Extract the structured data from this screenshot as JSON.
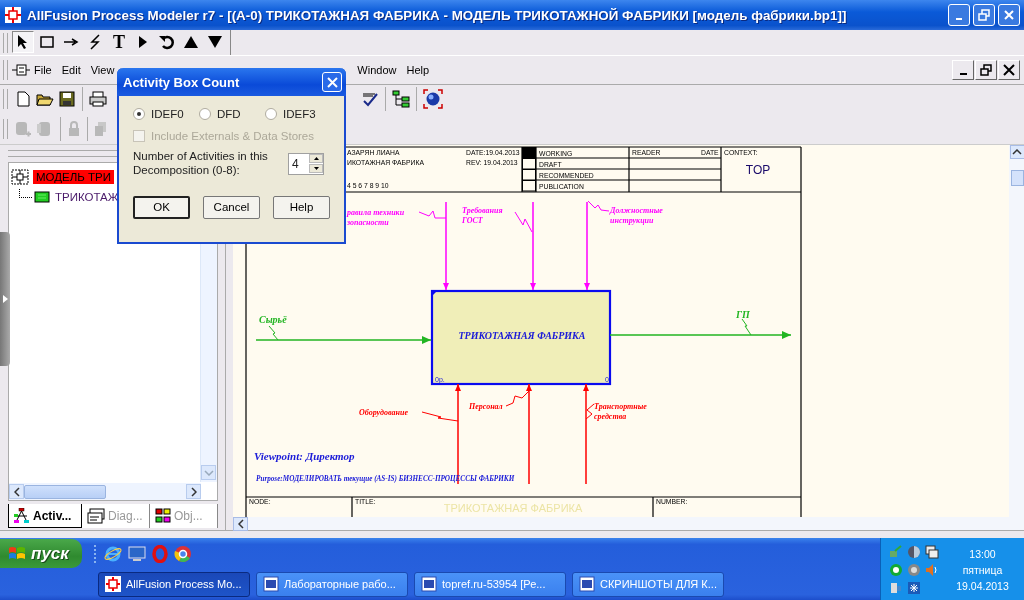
{
  "window": {
    "title": "AllFusion Process Modeler r7 - [(A-0) ТРИКОТАЖНАЯ ФАБРИКА - МОДЕЛЬ ТРИКОТАЖНОЙ ФАБРИКИ  [модель фабрики.bp1]]"
  },
  "drawing_toolbar": [
    {
      "kind": "pointer",
      "selected": true
    },
    {
      "kind": "box",
      "selected": false
    },
    {
      "kind": "arrow",
      "selected": false
    },
    {
      "kind": "squiggle",
      "selected": false
    },
    {
      "kind": "text",
      "glyph": "T",
      "selected": false
    },
    {
      "kind": "play",
      "selected": false
    },
    {
      "kind": "rotate",
      "selected": false
    },
    {
      "kind": "up",
      "selected": false
    },
    {
      "kind": "down",
      "selected": false
    }
  ],
  "menu": [
    "File",
    "Edit",
    "View",
    "Window",
    "Help"
  ],
  "standard_toolbar": [
    {
      "kind": "new"
    },
    {
      "kind": "open"
    },
    {
      "kind": "save"
    },
    {
      "kind": "print"
    },
    {
      "kind": "spellcheck"
    },
    {
      "kind": "tree"
    },
    {
      "kind": "globe"
    }
  ],
  "model_toolbar": [
    {
      "kind": "box-add"
    },
    {
      "kind": "box-remove"
    },
    {
      "kind": "lock"
    },
    {
      "kind": "copy"
    }
  ],
  "tree": [
    {
      "label": "МОДЕЛЬ ТРИ",
      "selected": true,
      "children": [
        {
          "label": "ТРИКОТАЖ",
          "selected": false
        }
      ]
    }
  ],
  "panel_tabs": [
    {
      "label": "Activ...",
      "kind": "activity",
      "selected": true
    },
    {
      "label": "Diag...",
      "kind": "diagram",
      "selected": false
    },
    {
      "label": "Obj...",
      "kind": "objects",
      "selected": false
    }
  ],
  "diagram": {
    "header": {
      "author": "АЗАРЯН ЛИАНА",
      "project": "ИКОТАЖНАЯ ФАБРИКА",
      "notes": "4  5  6  7  8  9  10",
      "date": "DATE:19.04.2013",
      "rev": "REV:   19.04.2013",
      "statuses": [
        {
          "label": "WORKING",
          "selected": true
        },
        {
          "label": "DRAFT",
          "selected": false
        },
        {
          "label": "RECOMMENDED",
          "selected": false
        },
        {
          "label": "PUBLICATION",
          "selected": false
        }
      ],
      "reader": "READER",
      "reader_date": "DATE",
      "context_label": "CONTEXT:",
      "context": "TOP"
    },
    "activity": {
      "name": "ТРИКОТАЖНАЯ ФАБРИКА",
      "cost": "0р.",
      "number": "0"
    },
    "arrows": [
      {
        "kind": "control",
        "lines": [
          "равила техники",
          "зопасности"
        ]
      },
      {
        "kind": "control",
        "lines": [
          "Требования",
          "ГОСТ"
        ]
      },
      {
        "kind": "control",
        "lines": [
          "Должностные",
          "инструкции"
        ]
      },
      {
        "kind": "input",
        "lines": [
          "Сырьё"
        ]
      },
      {
        "kind": "output",
        "lines": [
          "ГП"
        ]
      },
      {
        "kind": "mechanism",
        "lines": [
          "Оборудование"
        ]
      },
      {
        "kind": "mechanism",
        "lines": [
          "Персонал"
        ]
      },
      {
        "kind": "mechanism",
        "lines": [
          "Транспортные",
          "средства"
        ]
      }
    ],
    "viewpoint": "Viewpoint: Директор",
    "purpose": "Purpose:МОДЕЛИРОВАТЬ текущие (AS-IS) БИЗНЕСС-ПРОЦЕССЫ ФАБРИКИ",
    "footer": {
      "node": "NODE:",
      "title_label": "TITLE:",
      "title": "ТРИКОТАЖНАЯ ФАБРИКА",
      "number": "NUMBER:"
    }
  },
  "dialog": {
    "title": "Activity Box Count",
    "radios": [
      {
        "label": "IDEF0",
        "selected": true
      },
      {
        "label": "DFD",
        "selected": false
      },
      {
        "label": "IDEF3",
        "selected": false
      }
    ],
    "checkbox": {
      "label": "Include Externals & Data Stores",
      "checked": false,
      "disabled": true
    },
    "count_label": "Number of Activities in this Decomposition (0-8):",
    "count": "4",
    "buttons": [
      {
        "label": "OK",
        "default": true
      },
      {
        "label": "Cancel",
        "default": false
      },
      {
        "label": "Help",
        "default": false
      }
    ]
  },
  "taskbar": {
    "start": "пуск",
    "quick_launch": [
      {
        "kind": "ie"
      },
      {
        "kind": "desktop"
      },
      {
        "kind": "opera"
      },
      {
        "kind": "chrome"
      }
    ],
    "tasks": [
      {
        "label": "AllFusion Process Mo...",
        "kind": "app",
        "selected": true
      },
      {
        "label": "Лабораторные рабо...",
        "kind": "word",
        "selected": false
      },
      {
        "label": "topref.ru-53954 [Ре...",
        "kind": "word",
        "selected": false
      },
      {
        "label": "СКРИНШОТЫ ДЛЯ К...",
        "kind": "word",
        "selected": false
      }
    ],
    "clock": {
      "time": "13:00",
      "day": "пятница",
      "date": "19.04.2013"
    }
  }
}
